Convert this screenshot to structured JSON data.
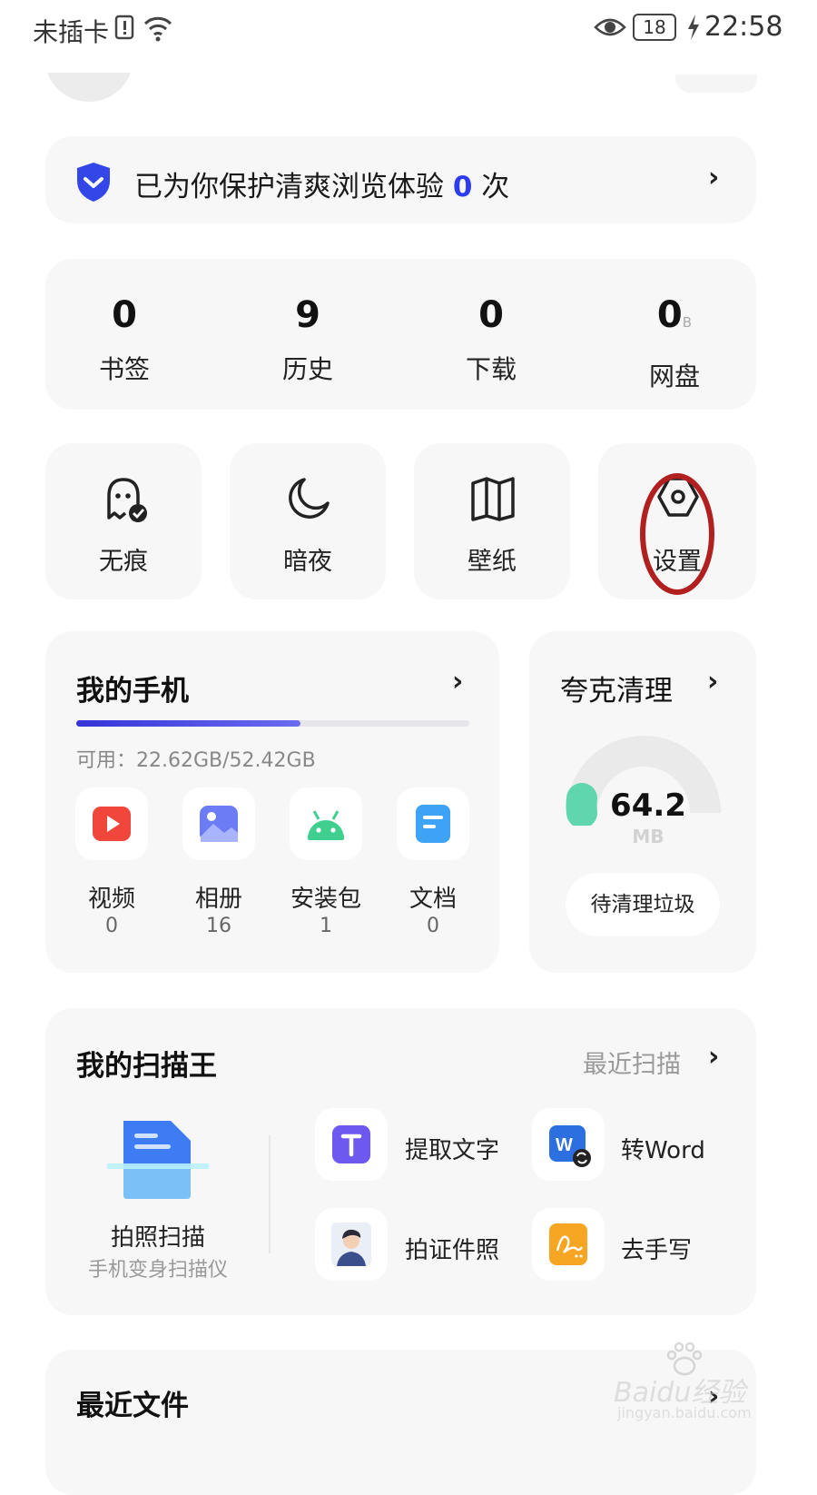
{
  "status_bar": {
    "sim": "未插卡",
    "battery": "18",
    "time": "22:58"
  },
  "protect": {
    "prefix": "已为你保护清爽浏览体验",
    "count": "0",
    "suffix": "次"
  },
  "stats": [
    {
      "value": "0",
      "label": "书签"
    },
    {
      "value": "9",
      "label": "历史"
    },
    {
      "value": "0",
      "label": "下载"
    },
    {
      "value": "0",
      "unit": "B",
      "label": "网盘"
    }
  ],
  "quick": [
    {
      "label": "无痕",
      "icon": "incognito-ghost-icon"
    },
    {
      "label": "暗夜",
      "icon": "moon-icon"
    },
    {
      "label": "壁纸",
      "icon": "wallpaper-icon"
    },
    {
      "label": "设置",
      "icon": "settings-hex-icon"
    }
  ],
  "phone": {
    "title": "我的手机",
    "storage_text": "可用：22.62GB/52.42GB",
    "storage_used_fraction": 0.57,
    "apps": [
      {
        "label": "视频",
        "count": "0",
        "icon": "video-icon",
        "color": "#f0463c"
      },
      {
        "label": "相册",
        "count": "16",
        "icon": "album-icon",
        "color": "#6b7cf5"
      },
      {
        "label": "安装包",
        "count": "1",
        "icon": "android-icon",
        "color": "#3fcf8e"
      },
      {
        "label": "文档",
        "count": "0",
        "icon": "document-icon",
        "color": "#3fa3f5"
      }
    ]
  },
  "cleaner": {
    "title": "夸克清理",
    "value": "64.2",
    "unit": "MB",
    "button": "待清理垃圾"
  },
  "scanner": {
    "title": "我的扫描王",
    "recent": "最近扫描",
    "main_label": "拍照扫描",
    "main_sub": "手机变身扫描仪",
    "tools": [
      {
        "label": "提取文字",
        "icon": "text-extract-icon"
      },
      {
        "label": "转Word",
        "icon": "word-convert-icon"
      },
      {
        "label": "拍证件照",
        "icon": "id-photo-icon"
      },
      {
        "label": "去手写",
        "icon": "remove-handwriting-icon"
      }
    ]
  },
  "recent_files": {
    "title": "最近文件"
  },
  "watermark": {
    "brand": "Baidu经验",
    "url": "jingyan.baidu.com"
  },
  "colors": {
    "accent": "#2e3cf0",
    "card": "#f7f7f8",
    "annotation": "#b11f1f"
  }
}
